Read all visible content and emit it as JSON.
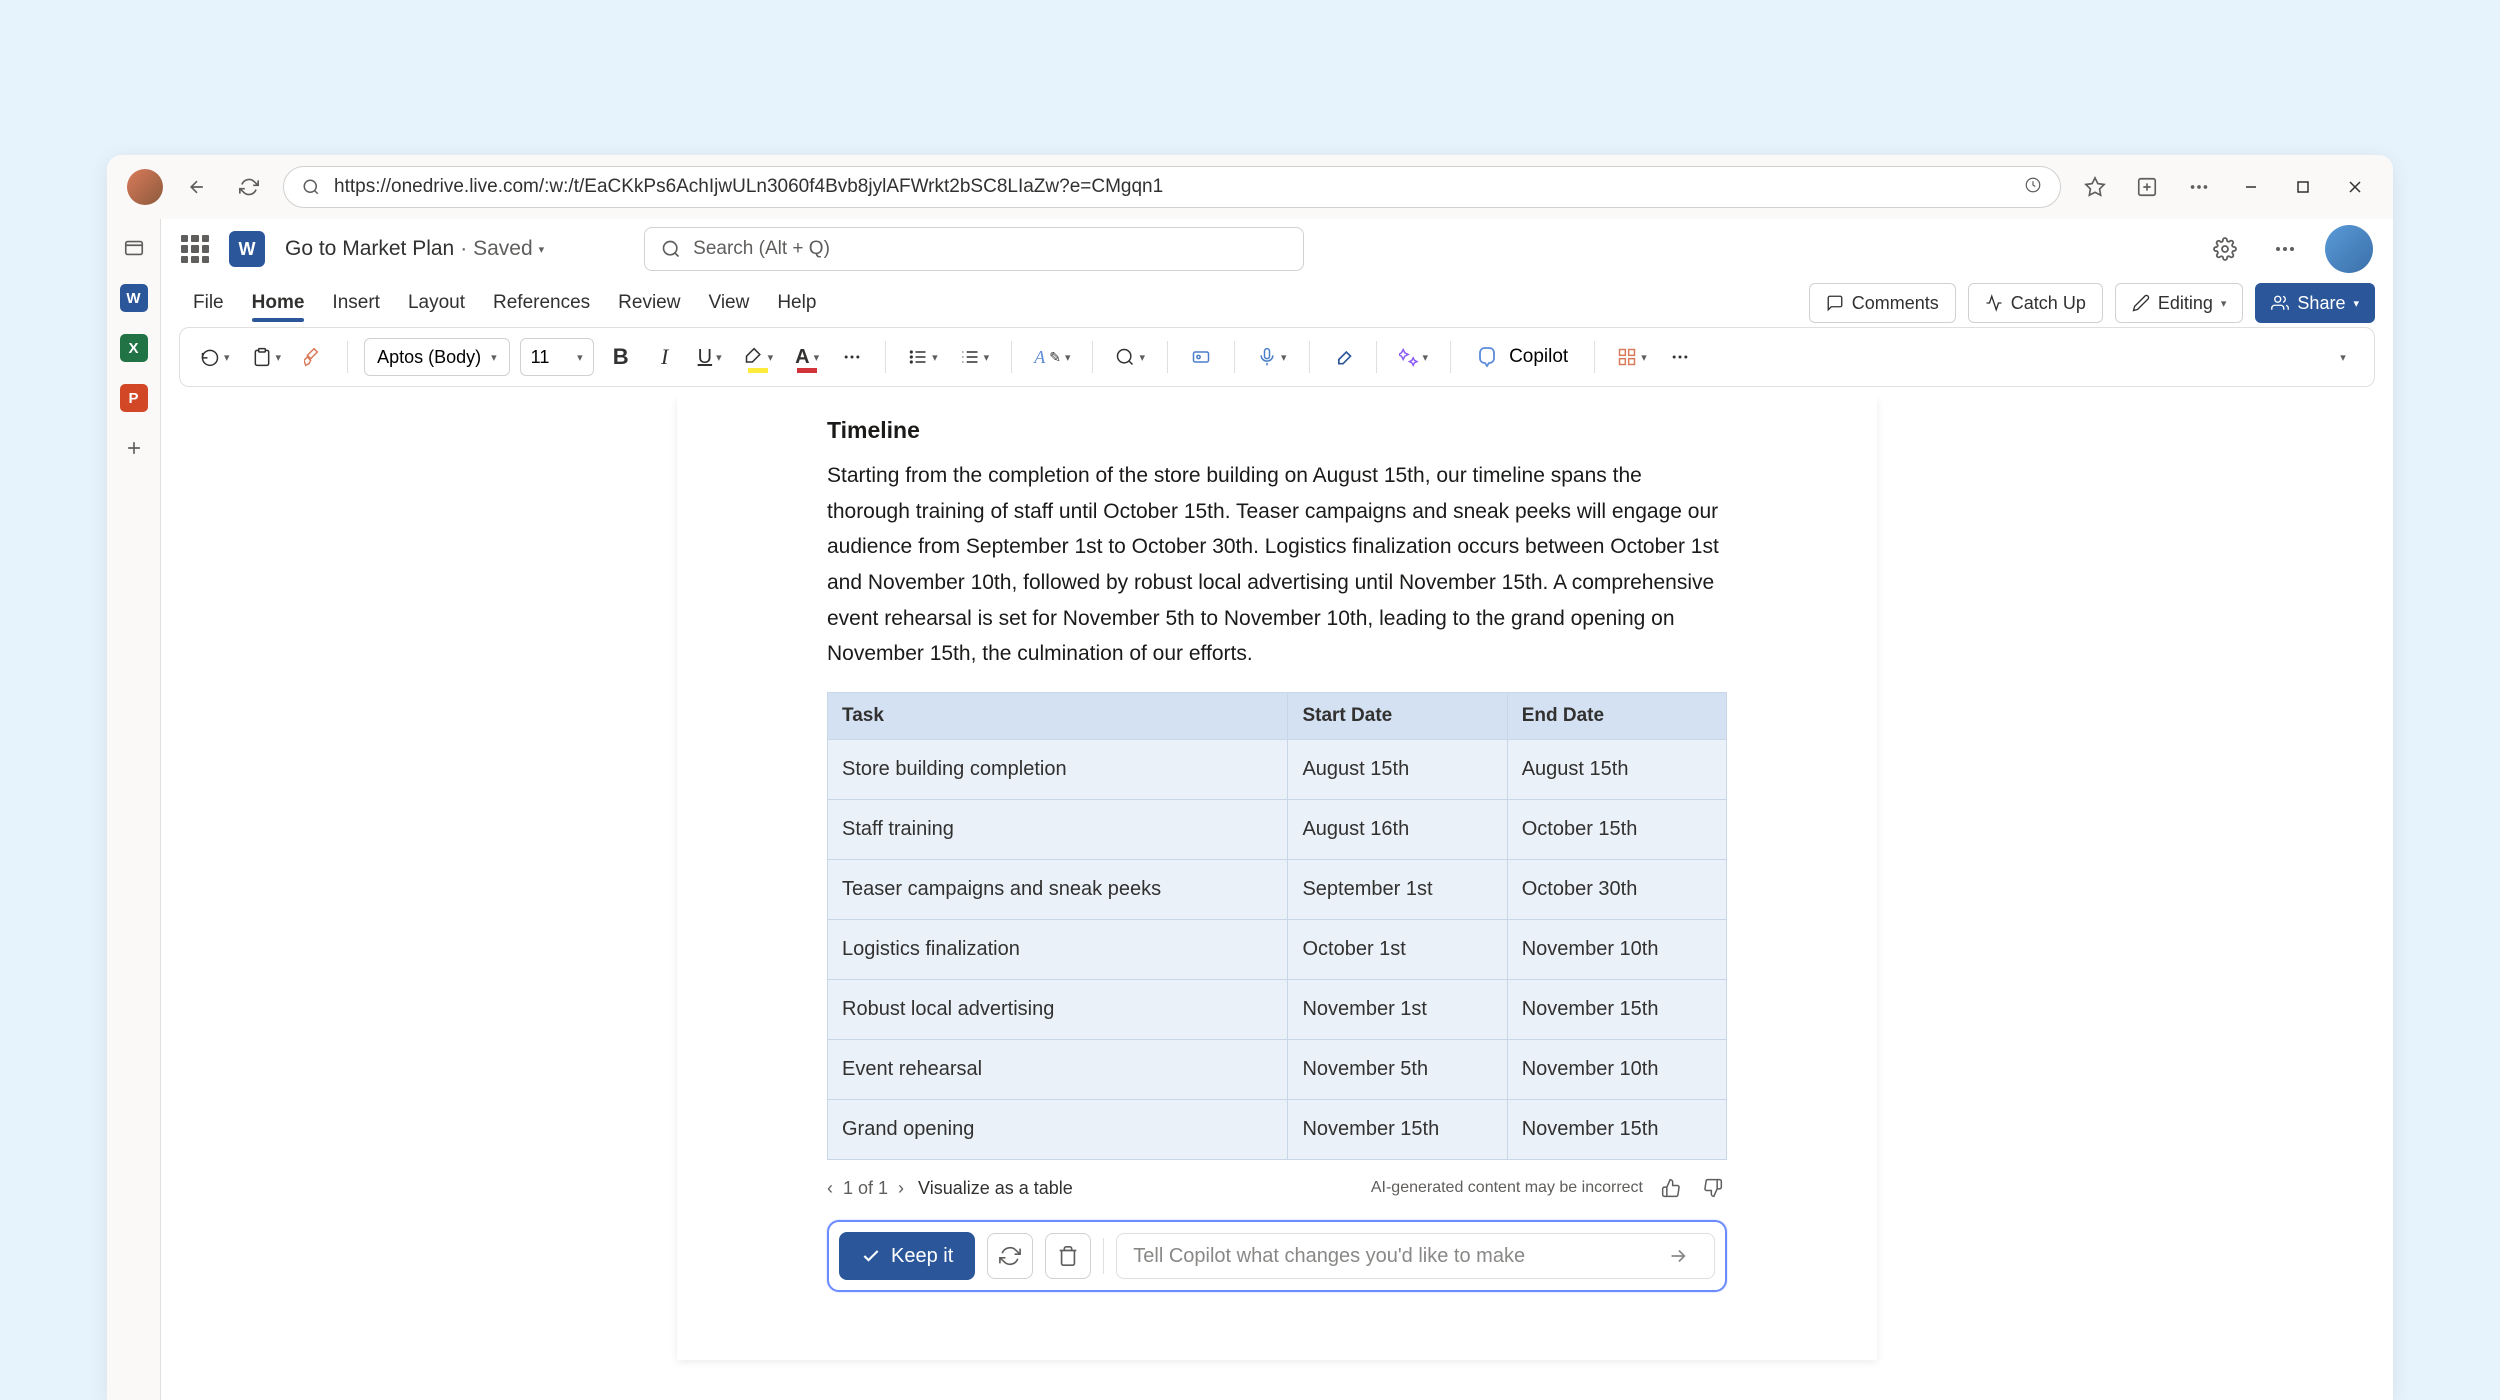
{
  "browser": {
    "url": "https://onedrive.live.com/:w:/t/EaCKkPs6AchIjwULn3060f4Bvb8jylAFWrkt2bSC8LIaZw?e=CMgqn1"
  },
  "header": {
    "doc_name": "Go to Market Plan",
    "saved_label": "· Saved",
    "search_placeholder": "Search (Alt + Q)"
  },
  "tabs": {
    "file": "File",
    "home": "Home",
    "insert": "Insert",
    "layout": "Layout",
    "references": "References",
    "review": "Review",
    "view": "View",
    "help": "Help"
  },
  "actions": {
    "comments": "Comments",
    "catchup": "Catch Up",
    "editing": "Editing",
    "share": "Share"
  },
  "ribbon": {
    "font_name": "Aptos (Body)",
    "font_size": "11",
    "copilot": "Copilot"
  },
  "document": {
    "heading": "Timeline",
    "paragraph": "Starting from the completion of the store building on August 15th, our timeline spans the thorough training of staff until October 15th. Teaser campaigns and sneak peeks will engage our audience from September 1st to October 30th. Logistics finalization occurs between October 1st and November 10th, followed by robust local advertising until November 15th. A comprehensive event rehearsal is set for November 5th to November 10th, leading to the grand opening on November 15th, the culmination of our efforts.",
    "table_headers": {
      "task": "Task",
      "start": "Start Date",
      "end": "End Date"
    },
    "rows": [
      {
        "task": "Store building completion",
        "start": "August 15th",
        "end": "August 15th"
      },
      {
        "task": "Staff training",
        "start": "August 16th",
        "end": "October 15th"
      },
      {
        "task": "Teaser campaigns and sneak peeks",
        "start": "September 1st",
        "end": "October 30th"
      },
      {
        "task": "Logistics finalization",
        "start": "October 1st",
        "end": "November 10th"
      },
      {
        "task": "Robust local advertising",
        "start": "November 1st",
        "end": "November 15th"
      },
      {
        "task": "Event rehearsal",
        "start": "November 5th",
        "end": "November 10th"
      },
      {
        "task": "Grand opening",
        "start": "November 15th",
        "end": "November 15th"
      }
    ]
  },
  "ai_footer": {
    "page_indicator": "1 of 1",
    "visualize": "Visualize as a table",
    "disclaimer": "AI-generated content may be incorrect"
  },
  "copilot_bar": {
    "keep": "Keep it",
    "placeholder": "Tell Copilot what changes you'd like to make"
  }
}
